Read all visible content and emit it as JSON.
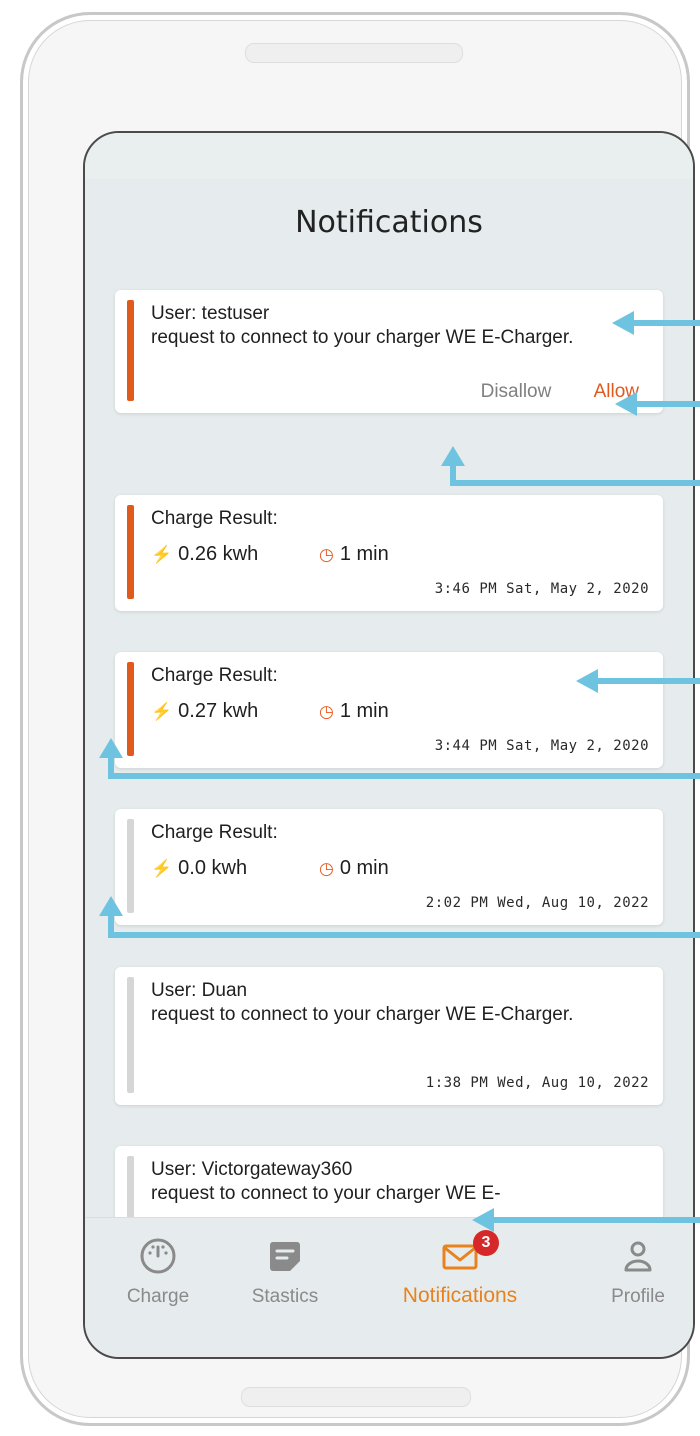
{
  "screen": {
    "title": "Notifications"
  },
  "colors": {
    "accent": "#e05a1e",
    "tab_active": "#e8821e",
    "badge": "#d62828",
    "annotation_arrow": "#6ec4e0"
  },
  "notifications": [
    {
      "type": "request",
      "user": "User: testuser",
      "message": "request to connect to your charger WE E-Charger.",
      "disallow_label": "Disallow",
      "allow_label": "Allow",
      "unread": true
    },
    {
      "type": "charge",
      "heading": "Charge Result:",
      "energy": "0.26 kwh",
      "duration": "1 min",
      "time": "3:46 PM Sat, May 2, 2020",
      "unread": true
    },
    {
      "type": "charge",
      "heading": "Charge Result:",
      "energy": "0.27 kwh",
      "duration": "1 min",
      "time": "3:44 PM Sat, May 2, 2020",
      "unread": true
    },
    {
      "type": "charge",
      "heading": "Charge Result:",
      "energy": "0.0 kwh",
      "duration": "0 min",
      "time": "2:02 PM Wed, Aug 10, 2022",
      "unread": false
    },
    {
      "type": "request",
      "user": "User: Duan",
      "message": "request to connect to your charger WE E-Charger.",
      "time": "1:38 PM Wed, Aug 10, 2022",
      "unread": false
    },
    {
      "type": "request",
      "user": "User: Victorgateway360",
      "message": "request to connect to your charger WE E-",
      "unread": false
    }
  ],
  "tabs": [
    {
      "label": "Charge",
      "icon": "gauge-icon",
      "active": false
    },
    {
      "label": "Stastics",
      "icon": "report-icon",
      "active": false
    },
    {
      "label": "Notifications",
      "icon": "envelope-icon",
      "active": true,
      "badge": "3"
    },
    {
      "label": "Profile",
      "icon": "person-icon",
      "active": false
    }
  ]
}
